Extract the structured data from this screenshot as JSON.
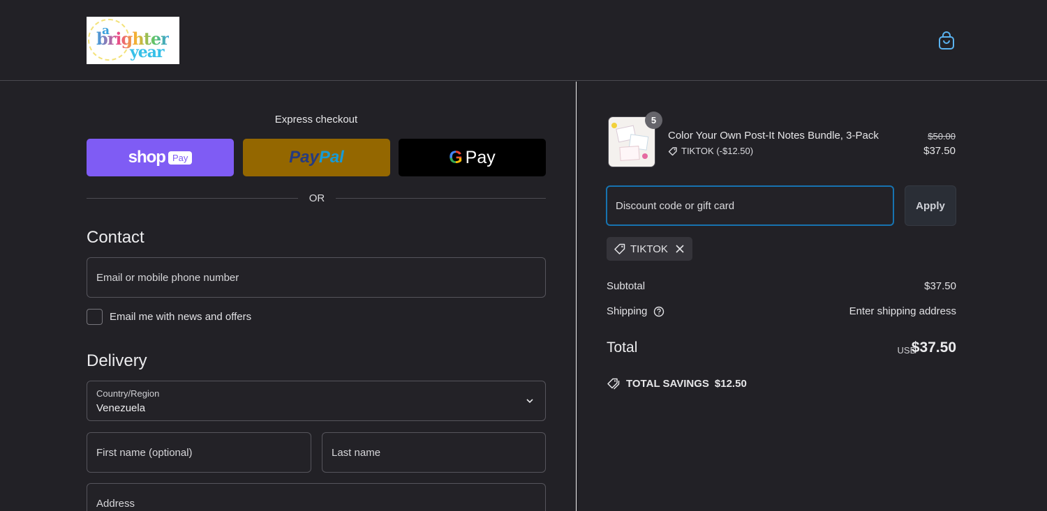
{
  "header": {
    "logo": {
      "line1": "a",
      "line2": "brighter",
      "line3": "year"
    },
    "cart_icon": "shopping-bag-icon"
  },
  "express": {
    "title": "Express checkout",
    "shop_pay": {
      "word": "shop",
      "badge": "Pay"
    },
    "paypal": {
      "part1": "Pay",
      "part2": "Pal"
    },
    "gpay": {
      "g": "G",
      "word": "Pay"
    },
    "or_text": "OR"
  },
  "contact": {
    "title": "Contact",
    "email_placeholder": "Email or mobile phone number",
    "newsletter_label": "Email me with news and offers"
  },
  "delivery": {
    "title": "Delivery",
    "country_label": "Country/Region",
    "country_value": "Venezuela",
    "first_name_placeholder": "First name (optional)",
    "last_name_placeholder": "Last name",
    "address_placeholder": "Address"
  },
  "order": {
    "item": {
      "quantity": "5",
      "name": "Color Your Own Post-It Notes Bundle, 3-Pack",
      "discount": "TIKTOK (-$12.50)",
      "original_price": "$50.00",
      "price": "$37.50"
    },
    "discount_placeholder": "Discount code or gift card",
    "apply_label": "Apply",
    "applied_code": "TIKTOK",
    "subtotal_label": "Subtotal",
    "subtotal_value": "$37.50",
    "shipping_label": "Shipping",
    "shipping_value": "Enter shipping address",
    "total_label": "Total",
    "currency": "USD",
    "total_value": "$37.50",
    "savings_label": "TOTAL SAVINGS",
    "savings_value": "$12.50"
  },
  "colors": {
    "background": "#222126",
    "shop_pay": "#7f5cf4",
    "paypal": "#946700",
    "gpay": "#000000",
    "focus_border": "#1773b0"
  }
}
